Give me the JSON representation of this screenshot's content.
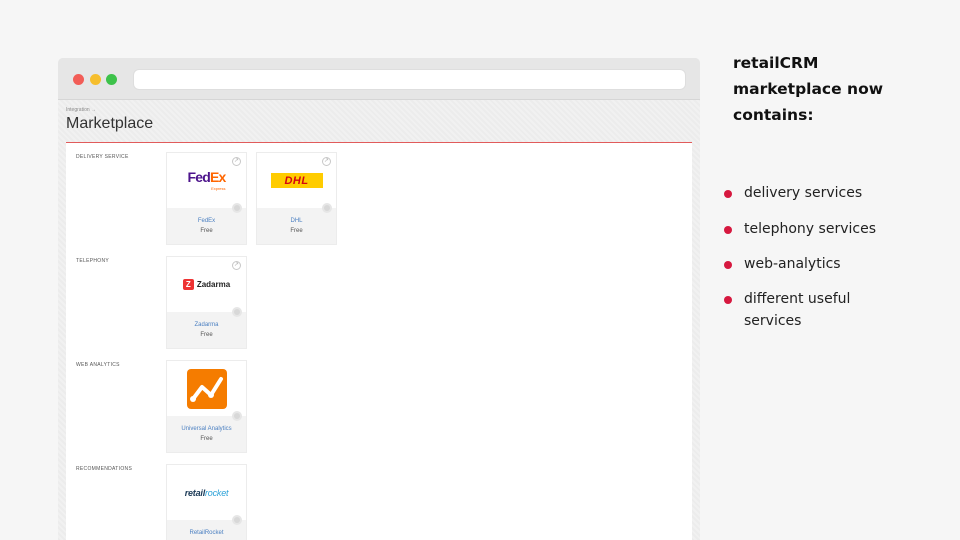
{
  "browser": {
    "breadcrumb": "Integration →",
    "page_title": "Marketplace"
  },
  "sections": [
    {
      "label": "DELIVERY SERVICE"
    },
    {
      "label": "TELEPHONY"
    },
    {
      "label": "WEB ANALYTICS"
    },
    {
      "label": "RECOMMENDATIONS"
    }
  ],
  "cards": {
    "fedex": {
      "name": "FedEx",
      "price": "Free",
      "logo_main_1": "Fed",
      "logo_main_2": "Ex",
      "logo_sub": "Express"
    },
    "dhl": {
      "name": "DHL",
      "price": "Free",
      "logo_text": "DHL"
    },
    "zadarma": {
      "name": "Zadarma",
      "price": "Free",
      "logo_text": "Zadarma"
    },
    "universal_analytics": {
      "name": "Universal Analytics",
      "price": "Free"
    },
    "retailrocket": {
      "name": "RetailRocket",
      "logo_1": "retail",
      "logo_2": "rocket"
    }
  },
  "sidebar_text": {
    "heading": "retailCRM\nmarketplace now\ncontains:",
    "bullets": [
      "delivery services",
      "telephony services",
      "web-analytics",
      "different useful services"
    ]
  },
  "colors": {
    "accent_bullet": "#d6183f",
    "title_underline": "#e15b5b",
    "link_blue": "#4a7fc1",
    "ga_orange": "#f57c00"
  }
}
